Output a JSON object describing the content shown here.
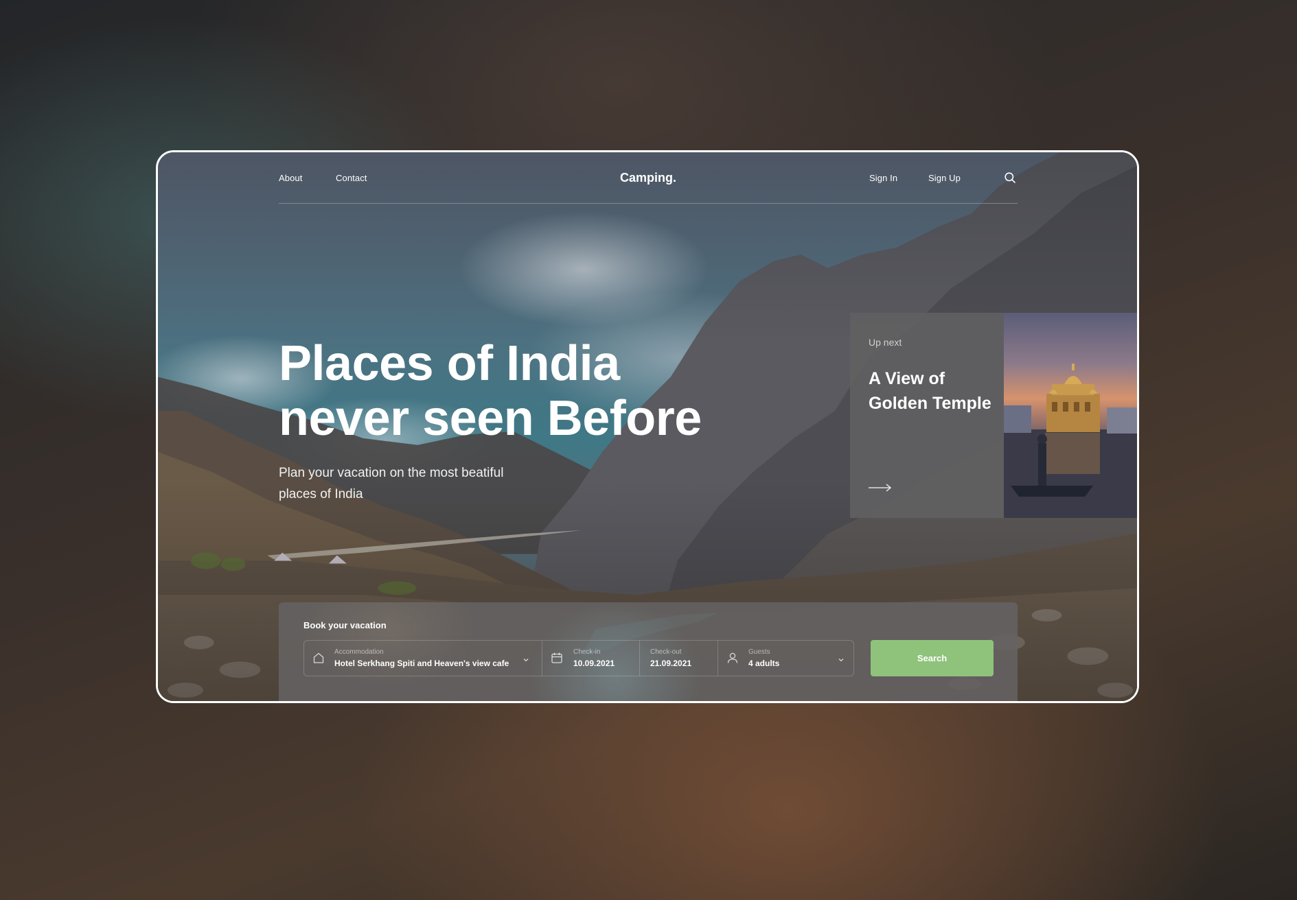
{
  "nav": {
    "about": "About",
    "contact": "Contact",
    "brand": "Camping.",
    "sign_in": "Sign In",
    "sign_up": "Sign Up",
    "search_icon": "search-icon"
  },
  "hero": {
    "title": "Places of India never seen Before",
    "subtitle": "Plan your vacation on the most beatiful places of India"
  },
  "up_next": {
    "label": "Up next",
    "title": "A View of Golden Temple",
    "arrow_icon": "arrow-right-icon"
  },
  "booking": {
    "heading": "Book your vacation",
    "accommodation": {
      "label": "Accommodation",
      "value": "Hotel Serkhang Spiti and Heaven's view cafe",
      "icon": "home-icon"
    },
    "check_in": {
      "label": "Check-in",
      "value": "10.09.2021",
      "icon": "calendar-icon"
    },
    "check_out": {
      "label": "Check-out",
      "value": "21.09.2021"
    },
    "guests": {
      "label": "Guests",
      "value": "4 adults",
      "icon": "user-icon"
    },
    "search_button": "Search"
  },
  "colors": {
    "accent_green": "#8fc37c",
    "text": "#ffffff",
    "frame_border": "#ffffff"
  }
}
